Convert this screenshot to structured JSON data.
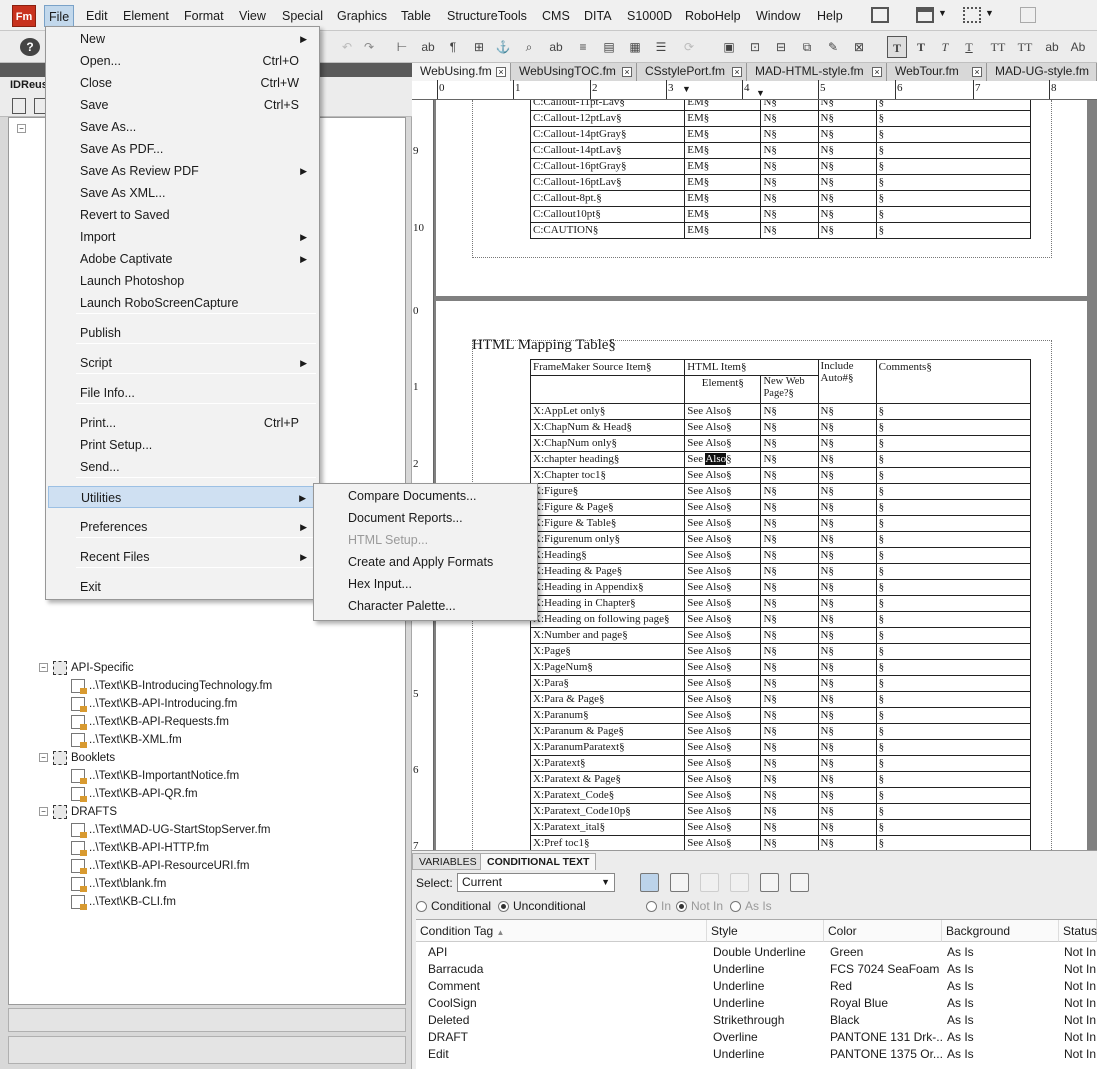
{
  "app": {
    "icon": "Fm"
  },
  "menubar": [
    "File",
    "Edit",
    "Element",
    "Format",
    "View",
    "Special",
    "Graphics",
    "Table",
    "StructureTools",
    "CMS",
    "DITA",
    "S1000D",
    "RoboHelp",
    "Window",
    "Help"
  ],
  "left_pane": {
    "title": "IDReus",
    "tree": [
      {
        "label": "API-Specific",
        "type": "group"
      },
      {
        "label": "..\\Text\\KB-IntroducingTechnology.fm",
        "type": "file"
      },
      {
        "label": "..\\Text\\KB-API-Introducing.fm",
        "type": "file"
      },
      {
        "label": "..\\Text\\KB-API-Requests.fm",
        "type": "file"
      },
      {
        "label": "..\\Text\\KB-XML.fm",
        "type": "file"
      },
      {
        "label": "Booklets",
        "type": "group"
      },
      {
        "label": "..\\Text\\KB-ImportantNotice.fm",
        "type": "file"
      },
      {
        "label": "..\\Text\\KB-API-QR.fm",
        "type": "file"
      },
      {
        "label": "DRAFTS",
        "type": "group"
      },
      {
        "label": "..\\Text\\MAD-UG-StartStopServer.fm",
        "type": "file"
      },
      {
        "label": "..\\Text\\KB-API-HTTP.fm",
        "type": "file"
      },
      {
        "label": "..\\Text\\KB-API-ResourceURI.fm",
        "type": "file"
      },
      {
        "label": "..\\Text\\blank.fm",
        "type": "file"
      },
      {
        "label": "..\\Text\\KB-CLI.fm",
        "type": "file"
      }
    ],
    "partial_k": "k"
  },
  "file_menu": [
    {
      "label": "New",
      "shortcut": "",
      "submenu": true
    },
    {
      "label": "Open...",
      "shortcut": "Ctrl+O",
      "submenu": false
    },
    {
      "label": "Close",
      "shortcut": "Ctrl+W",
      "submenu": false
    },
    {
      "label": "Save",
      "shortcut": "Ctrl+S",
      "submenu": false
    },
    {
      "label": "Save As...",
      "shortcut": "",
      "submenu": false
    },
    {
      "label": "Save As PDF...",
      "shortcut": "",
      "submenu": false
    },
    {
      "label": "Save As Review PDF",
      "shortcut": "",
      "submenu": true
    },
    {
      "label": "Save As XML...",
      "shortcut": "",
      "submenu": false
    },
    {
      "label": "Revert to Saved",
      "shortcut": "",
      "submenu": false
    },
    {
      "label": "Import",
      "shortcut": "",
      "submenu": true
    },
    {
      "label": "Adobe Captivate",
      "shortcut": "",
      "submenu": true
    },
    {
      "label": "Launch Photoshop",
      "shortcut": "",
      "submenu": false
    },
    {
      "label": "Launch RoboScreenCapture",
      "shortcut": "",
      "submenu": false
    },
    {
      "label": "Publish",
      "shortcut": "",
      "submenu": false
    },
    {
      "label": "Script",
      "shortcut": "",
      "submenu": true
    },
    {
      "label": "File Info...",
      "shortcut": "",
      "submenu": false
    },
    {
      "label": "Print...",
      "shortcut": "Ctrl+P",
      "submenu": false
    },
    {
      "label": "Print Setup...",
      "shortcut": "",
      "submenu": false
    },
    {
      "label": "Send...",
      "shortcut": "",
      "submenu": false
    },
    {
      "label": "Utilities",
      "shortcut": "",
      "submenu": true
    },
    {
      "label": "Preferences",
      "shortcut": "",
      "submenu": true
    },
    {
      "label": "Recent Files",
      "shortcut": "",
      "submenu": true
    },
    {
      "label": "Exit",
      "shortcut": "",
      "submenu": false
    }
  ],
  "utilities_menu": [
    {
      "label": "Compare Documents...",
      "disabled": false
    },
    {
      "label": "Document Reports...",
      "disabled": false
    },
    {
      "label": "HTML Setup...",
      "disabled": true
    },
    {
      "label": "Create and Apply Formats",
      "disabled": false
    },
    {
      "label": "Hex Input...",
      "disabled": false
    },
    {
      "label": "Character Palette...",
      "disabled": false
    }
  ],
  "doc_tabs": [
    "WebUsing.fm",
    "WebUsingTOC.fm",
    "CSstylePort.fm",
    "MAD-HTML-style.fm",
    "WebTour.fm",
    "MAD-UG-style.fm"
  ],
  "ruler": {
    "h": [
      "0",
      "1",
      "2",
      "3",
      "4",
      "5",
      "6",
      "7",
      "8"
    ],
    "v_top": [
      "9",
      "10"
    ],
    "v_bottom": [
      "0",
      "1",
      "2",
      "5",
      "6",
      "7"
    ]
  },
  "document": {
    "top_rows": [
      [
        "C:Callout-11pt-Lav§",
        "EM§",
        "N§",
        "N§",
        "§"
      ],
      [
        "C:Callout-12ptLav§",
        "EM§",
        "N§",
        "N§",
        "§"
      ],
      [
        "C:Callout-14ptGray§",
        "EM§",
        "N§",
        "N§",
        "§"
      ],
      [
        "C:Callout-14ptLav§",
        "EM§",
        "N§",
        "N§",
        "§"
      ],
      [
        "C:Callout-16ptGray§",
        "EM§",
        "N§",
        "N§",
        "§"
      ],
      [
        "C:Callout-16ptLav§",
        "EM§",
        "N§",
        "N§",
        "§"
      ],
      [
        "C:Callout-8pt.§",
        "EM§",
        "N§",
        "N§",
        "§"
      ],
      [
        "C:Callout10pt§",
        "EM§",
        "N§",
        "N§",
        "§"
      ],
      [
        "C:CAUTION§",
        "EM§",
        "N§",
        "N§",
        "§"
      ]
    ],
    "heading": "HTML Mapping Table§",
    "header": {
      "col1": "FrameMaker Source Item§",
      "col2": "HTML Item§",
      "col2a": "Element§",
      "col2b": "New Web Page?§",
      "col3": "Include Auto#§",
      "col4": "Comments§"
    },
    "rows": [
      [
        "X:AppLet only§",
        "See Also§",
        "N§",
        "N§",
        "§"
      ],
      [
        "X:ChapNum & Head§",
        "See Also§",
        "N§",
        "N§",
        "§"
      ],
      [
        "X:ChapNum only§",
        "See Also§",
        "N§",
        "N§",
        "§"
      ],
      [
        "X:chapter heading§",
        "See Also§",
        "N§",
        "N§",
        "§"
      ],
      [
        "X:Chapter toc1§",
        "See Also§",
        "N§",
        "N§",
        "§"
      ],
      [
        "X:Figure§",
        "See Also§",
        "N§",
        "N§",
        "§"
      ],
      [
        "X:Figure & Page§",
        "See Also§",
        "N§",
        "N§",
        "§"
      ],
      [
        "X:Figure & Table§",
        "See Also§",
        "N§",
        "N§",
        "§"
      ],
      [
        "X:Figurenum only§",
        "See Also§",
        "N§",
        "N§",
        "§"
      ],
      [
        "X:Heading§",
        "See Also§",
        "N§",
        "N§",
        "§"
      ],
      [
        "X:Heading & Page§",
        "See Also§",
        "N§",
        "N§",
        "§"
      ],
      [
        "X:Heading in Appendix§",
        "See Also§",
        "N§",
        "N§",
        "§"
      ],
      [
        "X:Heading in Chapter§",
        "See Also§",
        "N§",
        "N§",
        "§"
      ],
      [
        "X:Heading on following page§",
        "See Also§",
        "N§",
        "N§",
        "§"
      ],
      [
        "X:Number and page§",
        "See Also§",
        "N§",
        "N§",
        "§"
      ],
      [
        "X:Page§",
        "See Also§",
        "N§",
        "N§",
        "§"
      ],
      [
        "X:PageNum§",
        "See Also§",
        "N§",
        "N§",
        "§"
      ],
      [
        "X:Para§",
        "See Also§",
        "N§",
        "N§",
        "§"
      ],
      [
        "X:Para & Page§",
        "See Also§",
        "N§",
        "N§",
        "§"
      ],
      [
        "X:Paranum§",
        "See Also§",
        "N§",
        "N§",
        "§"
      ],
      [
        "X:Paranum & Page§",
        "See Also§",
        "N§",
        "N§",
        "§"
      ],
      [
        "X:ParanumParatext§",
        "See Also§",
        "N§",
        "N§",
        "§"
      ],
      [
        "X:Paratext§",
        "See Also§",
        "N§",
        "N§",
        "§"
      ],
      [
        "X:Paratext & Page§",
        "See Also§",
        "N§",
        "N§",
        "§"
      ],
      [
        "X:Paratext_Code§",
        "See Also§",
        "N§",
        "N§",
        "§"
      ],
      [
        "X:Paratext_Code10p§",
        "See Also§",
        "N§",
        "N§",
        "§"
      ],
      [
        "X:Paratext_ital§",
        "See Also§",
        "N§",
        "N§",
        "§"
      ],
      [
        "X:Pref toc1§",
        "See Also§",
        "N§",
        "N§",
        "§"
      ]
    ]
  },
  "bottom_panel": {
    "tabs": [
      "VARIABLES",
      "CONDITIONAL TEXT"
    ],
    "select_label": "Select:",
    "select_value": "Current",
    "radio_conditional": "Conditional",
    "radio_unconditional": "Unconditional",
    "radio_in": "In",
    "radio_notin": "Not In",
    "radio_asis": "As Is",
    "columns": [
      "Condition Tag",
      "Style",
      "Color",
      "Background",
      "Status"
    ],
    "rows": [
      [
        "API",
        "Double Underline",
        "Green",
        "As Is",
        "Not In"
      ],
      [
        "Barracuda",
        "Underline",
        "FCS 7024 SeaFoam",
        "As Is",
        "Not In"
      ],
      [
        "Comment",
        "Underline",
        "Red",
        "As Is",
        "Not In"
      ],
      [
        "CoolSign",
        "Underline",
        "Royal Blue",
        "As Is",
        "Not In"
      ],
      [
        "Deleted",
        "Strikethrough",
        "Black",
        "As Is",
        "Not In"
      ],
      [
        "DRAFT",
        "Overline",
        "PANTONE 131 Drk-...",
        "As Is",
        "Not In"
      ],
      [
        "Edit",
        "Underline",
        "PANTONE 1375 Or...",
        "As Is",
        "Not In"
      ]
    ]
  }
}
